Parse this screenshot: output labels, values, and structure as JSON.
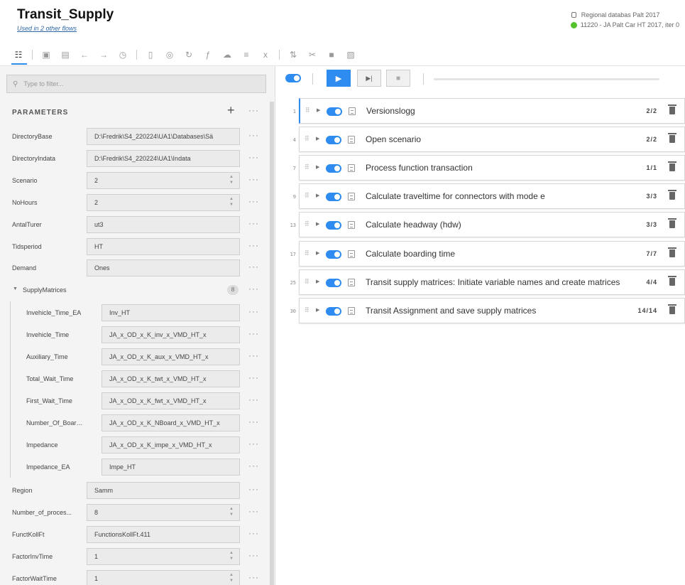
{
  "header": {
    "title": "Transit_Supply",
    "subtitle": "Used in 2 other flows",
    "database": "Regional databas Palt 2017",
    "scenario": "11220 - JA Palt Car HT 2017, iter 0"
  },
  "toolbar": {
    "icons": [
      "parameters-icon",
      "save-icon",
      "save-as-icon",
      "undo-icon",
      "redo-icon",
      "history-icon",
      "document-icon",
      "shield-icon",
      "refresh-icon",
      "function-icon",
      "cloud-icon",
      "list-icon",
      "variable-icon",
      "sort-icon",
      "cut-icon",
      "copy-icon",
      "paste-icon"
    ]
  },
  "left": {
    "filter_placeholder": "Type to filter...",
    "params_title": "PARAMETERS",
    "params": [
      {
        "label": "DirectoryBase",
        "value": "D:\\Fredrik\\S4_220224\\UA1\\Databases\\Sä"
      },
      {
        "label": "DirectoryIndata",
        "value": "D:\\Fredrik\\S4_220224\\UA1\\Indata"
      },
      {
        "label": "Scenario",
        "value": "2"
      },
      {
        "label": "NoHours",
        "value": "2"
      },
      {
        "label": "AntalTurer",
        "value": "ut3"
      },
      {
        "label": "Tidsperiod",
        "value": "HT"
      },
      {
        "label": "Demand",
        "value": "Ones"
      }
    ],
    "group": {
      "label": "SupplyMatrices",
      "count": "8",
      "items": [
        {
          "label": "Invehicle_Time_EA",
          "value": "Inv_HT"
        },
        {
          "label": "Invehicle_Time",
          "value": "JA_x_OD_x_K_inv_x_VMD_HT_x"
        },
        {
          "label": "Auxiliary_Time",
          "value": "JA_x_OD_x_K_aux_x_VMD_HT_x"
        },
        {
          "label": "Total_Wait_Time",
          "value": "JA_x_OD_x_K_twt_x_VMD_HT_x"
        },
        {
          "label": "First_Wait_Time",
          "value": "JA_x_OD_x_K_fwt_x_VMD_HT_x"
        },
        {
          "label": "Number_Of_Boardi...",
          "value": "JA_x_OD_x_K_NBoard_x_VMD_HT_x"
        },
        {
          "label": "Impedance",
          "value": "JA_x_OD_x_K_impe_x_VMD_HT_x"
        },
        {
          "label": "Impedance_EA",
          "value": "Impe_HT"
        }
      ]
    },
    "params2": [
      {
        "label": "Region",
        "value": "Samm"
      },
      {
        "label": "Number_of_proces...",
        "value": "8"
      },
      {
        "label": "FunctKollFt",
        "value": "FunctionsKollFt.411"
      },
      {
        "label": "FactorInvTime",
        "value": "1"
      },
      {
        "label": "FactorWaitTime",
        "value": "1"
      }
    ],
    "more_label": "···",
    "plus_label": "+"
  },
  "right": {
    "steps": [
      {
        "num": "1",
        "name": "Versionslogg",
        "count": "2/2"
      },
      {
        "num": "4",
        "name": "Open scenario",
        "count": "2/2"
      },
      {
        "num": "7",
        "name": "Process function transaction",
        "count": "1/1"
      },
      {
        "num": "9",
        "name": "Calculate traveltime for connectors with mode e",
        "count": "3/3"
      },
      {
        "num": "13",
        "name": "Calculate headway (hdw)",
        "count": "3/3"
      },
      {
        "num": "17",
        "name": "Calculate boarding time",
        "count": "7/7"
      },
      {
        "num": "25",
        "name": "Transit supply matrices: Initiate variable names and create matrices",
        "count": "4/4"
      },
      {
        "num": "30",
        "name": "Transit Assignment and save supply matrices",
        "count": "14/14"
      }
    ]
  },
  "colors": {
    "accent": "#2e8bf0",
    "status_green": "#53c22b"
  }
}
